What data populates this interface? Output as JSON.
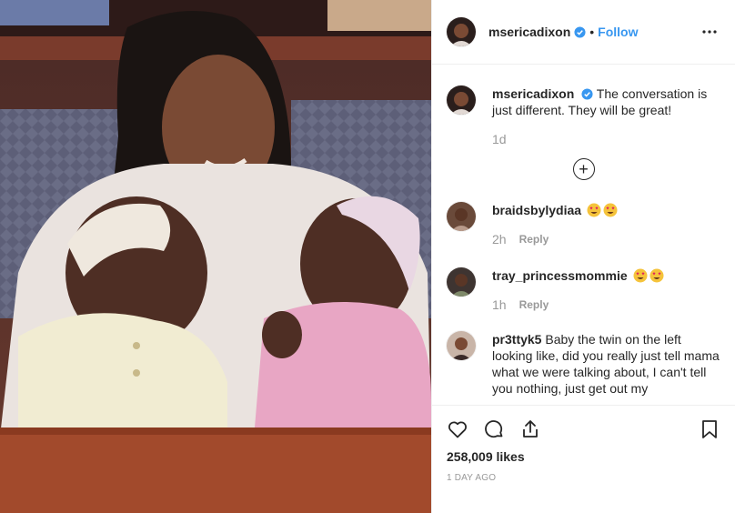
{
  "post": {
    "author": "mserica dixon",
    "follow_label": "Follow",
    "separator": "•",
    "caption_author": "msericadixon",
    "caption_text": "The conversation is just different. They will be great!",
    "caption_age": "1d",
    "load_more": "+"
  },
  "header": {
    "username": "msericadixon"
  },
  "comments": [
    {
      "user": "braidsbylydiaa",
      "text": "",
      "emoji_count": 2,
      "age": "2h",
      "reply_label": "Reply"
    },
    {
      "user": "tray_princessmommie",
      "text": "",
      "emoji_count": 2,
      "age": "1h",
      "reply_label": "Reply"
    },
    {
      "user": "pr3ttyk5",
      "text": "Baby the twin on the left looking like, did you really just tell mama what we were talking about, I can't tell you nothing, just get out my"
    }
  ],
  "footer": {
    "likes": "258,009 likes",
    "timestamp": "1 DAY AGO"
  },
  "icons": {
    "like": "heart-icon",
    "comment": "comment-icon",
    "share": "share-icon",
    "save": "bookmark-icon",
    "more": "more-icon",
    "verified": "verified-badge-icon"
  },
  "colors": {
    "link": "#3897f0",
    "muted": "#999999",
    "text": "#262626"
  }
}
